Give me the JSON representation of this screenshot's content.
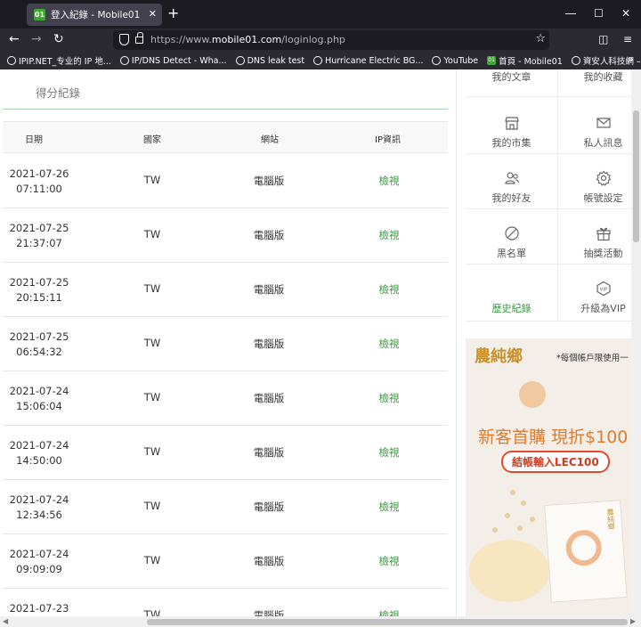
{
  "browser": {
    "tab_title": "登入紀錄 - Mobile01",
    "favicon_text": "01",
    "new_tab_symbol": "+",
    "close_symbol": "✕",
    "url_prefix": "https://www.",
    "url_host": "mobile01.com",
    "url_path": "/loginlog.php",
    "bookmarks": [
      {
        "label": "IPIP.NET_专业的 IP 地...",
        "icon": "globe-icon"
      },
      {
        "label": "IP/DNS Detect - Wha...",
        "icon": "globe-icon"
      },
      {
        "label": "DNS leak test",
        "icon": "globe-icon"
      },
      {
        "label": "Hurricane Electric BG...",
        "icon": "globe-icon"
      },
      {
        "label": "YouTube",
        "icon": "globe-icon"
      },
      {
        "label": "首頁 - Mobile01",
        "icon": "mobile01-icon"
      },
      {
        "label": "資安人科技網 – 關心...",
        "icon": "globe-icon"
      }
    ]
  },
  "page": {
    "section_title": "得分紀錄",
    "table": {
      "headers": [
        "日期",
        "國家",
        "網站",
        "IP資訊"
      ],
      "rows": [
        {
          "date": "2021-07-26",
          "time": "07:11:00",
          "country": "TW",
          "site": "電腦版",
          "ip": "檢視"
        },
        {
          "date": "2021-07-25",
          "time": "21:37:07",
          "country": "TW",
          "site": "電腦版",
          "ip": "檢視"
        },
        {
          "date": "2021-07-25",
          "time": "20:15:11",
          "country": "TW",
          "site": "電腦版",
          "ip": "檢視"
        },
        {
          "date": "2021-07-25",
          "time": "06:54:32",
          "country": "TW",
          "site": "電腦版",
          "ip": "檢視"
        },
        {
          "date": "2021-07-24",
          "time": "15:06:04",
          "country": "TW",
          "site": "電腦版",
          "ip": "檢視"
        },
        {
          "date": "2021-07-24",
          "time": "14:50:00",
          "country": "TW",
          "site": "電腦版",
          "ip": "檢視"
        },
        {
          "date": "2021-07-24",
          "time": "12:34:56",
          "country": "TW",
          "site": "電腦版",
          "ip": "檢視"
        },
        {
          "date": "2021-07-24",
          "time": "09:09:09",
          "country": "TW",
          "site": "電腦版",
          "ip": "檢視"
        },
        {
          "date": "2021-07-23",
          "time": "",
          "country": "TW",
          "site": "電腦版",
          "ip": "檢視"
        }
      ]
    }
  },
  "sidebar": {
    "menu": [
      {
        "label": "我的文章",
        "icon": "article-icon"
      },
      {
        "label": "我的收藏",
        "icon": "bookmark-icon"
      },
      {
        "label": "我的市集",
        "icon": "store-icon"
      },
      {
        "label": "私人訊息",
        "icon": "mail-icon"
      },
      {
        "label": "我的好友",
        "icon": "friends-icon"
      },
      {
        "label": "帳號設定",
        "icon": "gear-icon"
      },
      {
        "label": "黑名單",
        "icon": "block-icon"
      },
      {
        "label": "抽獎活動",
        "icon": "gift-icon"
      },
      {
        "label": "歷史紀錄",
        "icon": "history-icon"
      },
      {
        "label": "升級為VIP",
        "icon": "vip-icon"
      }
    ],
    "active_color": "#3a9a3f"
  },
  "ad": {
    "brand": "農純鄉",
    "note": "*每個帳戶限使用一",
    "promo": "新客首購 現折$100",
    "code": "結帳輸入LEC100",
    "box_label": "農純鄉"
  }
}
